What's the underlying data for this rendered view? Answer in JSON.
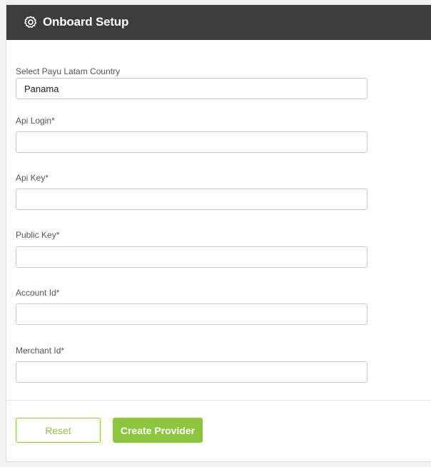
{
  "header": {
    "title": "Onboard Setup",
    "icon": "settings-icon"
  },
  "form": {
    "country": {
      "label": "Select Payu Latam Country",
      "value": "Panama"
    },
    "api_login": {
      "label": "Api Login*",
      "value": ""
    },
    "api_key": {
      "label": "Api Key*",
      "value": ""
    },
    "public_key": {
      "label": "Public Key*",
      "value": ""
    },
    "account_id": {
      "label": "Account Id*",
      "value": ""
    },
    "merchant_id": {
      "label": "Merchant Id*",
      "value": ""
    }
  },
  "actions": {
    "reset_label": "Reset",
    "create_label": "Create Provider"
  },
  "colors": {
    "header_bg": "#3c3c3c",
    "accent": "#8cc63f"
  }
}
